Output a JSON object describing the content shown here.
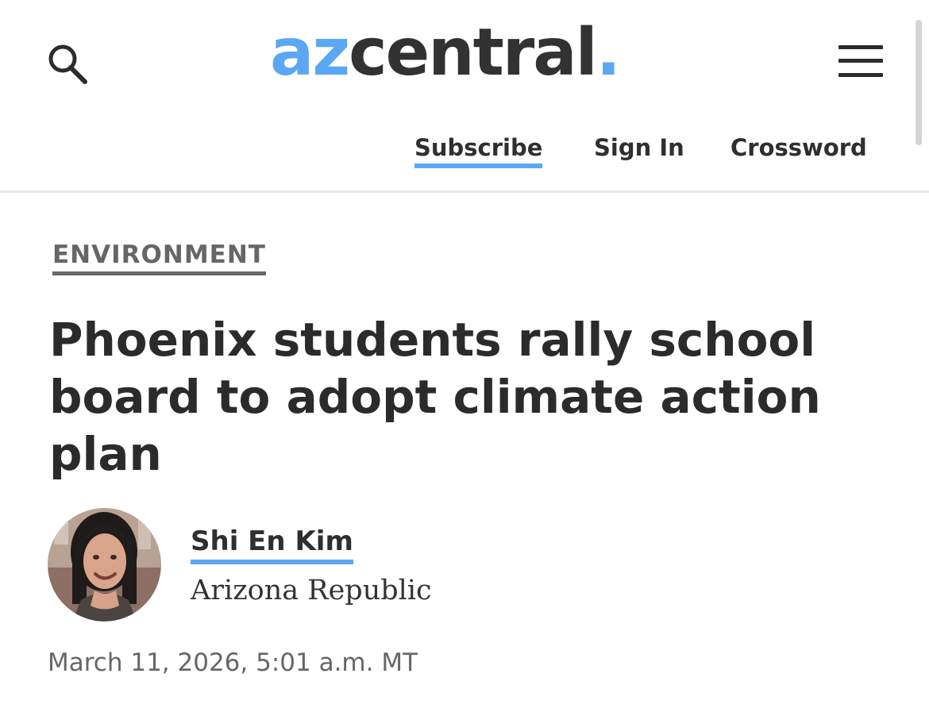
{
  "header": {
    "logo": {
      "prefix": "az",
      "main": "central",
      "suffix": "."
    },
    "nav": {
      "subscribe": "Subscribe",
      "sign_in": "Sign In",
      "crossword": "Crossword"
    },
    "icons": {
      "search": "search-icon",
      "menu": "hamburger-menu-icon"
    }
  },
  "article": {
    "section": "ENVIRONMENT",
    "headline": "Phoenix students rally school board to adopt climate action plan",
    "author": {
      "name": "Shi En Kim",
      "publication": "Arizona Republic",
      "avatar": "author-photo"
    },
    "timestamp": "March 11, 2026, 5:01 a.m. MT"
  },
  "colors": {
    "accent": "#5aa7f4",
    "text_primary": "#2c2c2c",
    "text_secondary": "#666666",
    "divider": "#e5e5e5"
  }
}
